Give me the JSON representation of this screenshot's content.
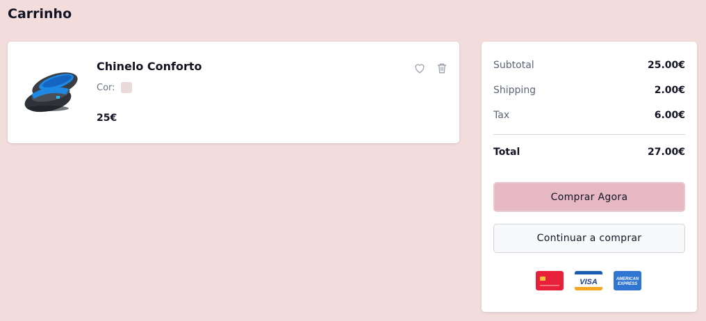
{
  "page": {
    "title": "Carrinho"
  },
  "cart": {
    "items": [
      {
        "name": "Chinelo Conforto",
        "color_label": "Cor:",
        "color_swatch": "#eadbdb",
        "price": "25€"
      }
    ]
  },
  "summary": {
    "subtotal_label": "Subtotal",
    "subtotal_value": "25.00€",
    "shipping_label": "Shipping",
    "shipping_value": "2.00€",
    "tax_label": "Tax",
    "tax_value": "6.00€",
    "total_label": "Total",
    "total_value": "27.00€",
    "buy_button": "Comprar Agora",
    "continue_button": "Continuar a comprar"
  },
  "payment_methods": [
    "credit-card-icon",
    "visa-icon",
    "amex-icon"
  ],
  "colors": {
    "background": "#f2dcdc",
    "buy_button": "#e5b8c4",
    "card": "#ffffff"
  }
}
